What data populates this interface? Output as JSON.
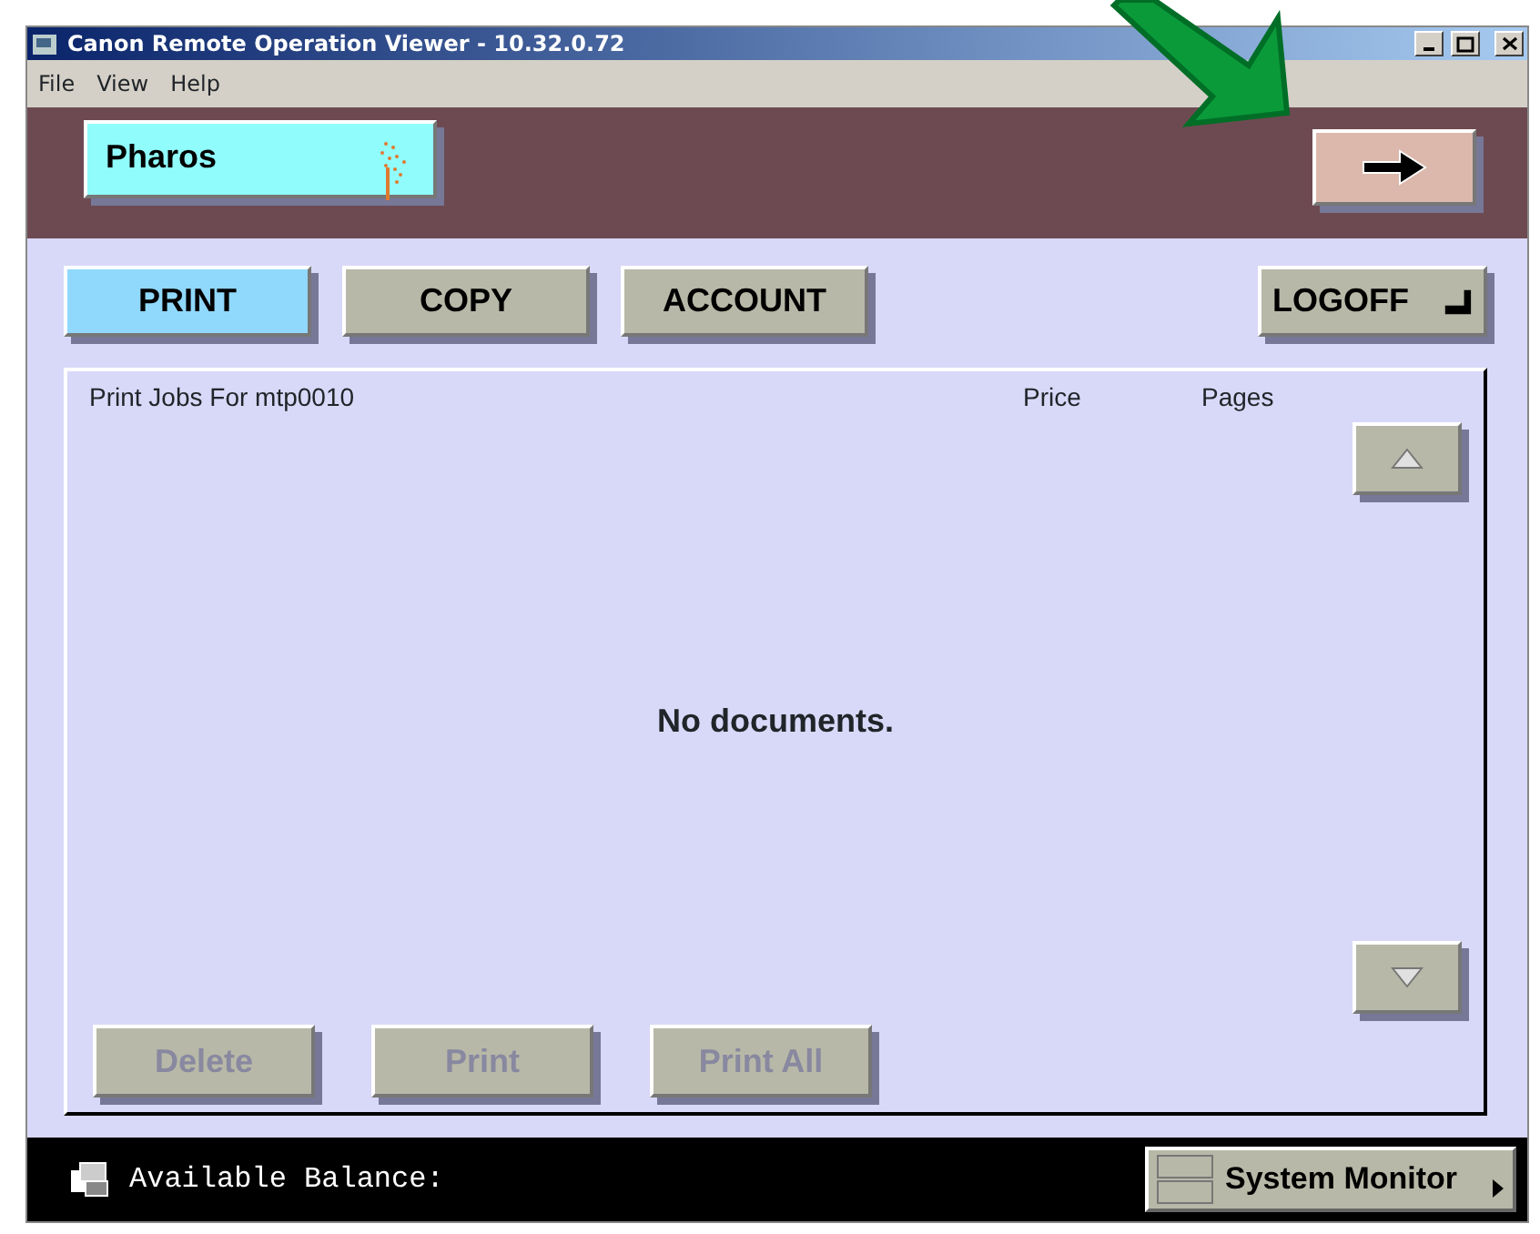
{
  "window": {
    "title": "Canon Remote Operation Viewer - 10.32.0.72"
  },
  "menu": [
    "File",
    "View",
    "Help"
  ],
  "brand": {
    "label": "Pharos"
  },
  "tabs": [
    {
      "label": "PRINT",
      "selected": true
    },
    {
      "label": "COPY",
      "selected": false
    },
    {
      "label": "ACCOUNT",
      "selected": false
    }
  ],
  "logoff": {
    "label": "LOGOFF"
  },
  "jobs": {
    "columns": [
      "Print Jobs For mtp0010",
      "Price",
      "Pages"
    ],
    "empty_message": "No documents."
  },
  "actions": [
    {
      "label": "Delete",
      "disabled": true
    },
    {
      "label": "Print",
      "disabled": true
    },
    {
      "label": "Print All",
      "disabled": true
    }
  ],
  "status_bar": {
    "balance_label": "Available Balance:",
    "monitor_button": "System Monitor"
  }
}
